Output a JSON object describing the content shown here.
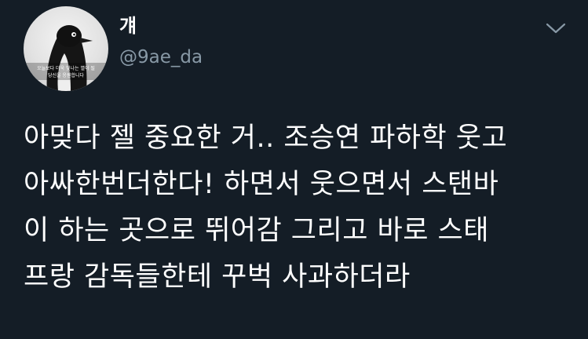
{
  "user": {
    "display_name": "걔",
    "handle": "@9ae_da",
    "avatar_caption_line1": "오늘보다 더욱 빛나는 별이 될",
    "avatar_caption_line2": "당신을 응원합니다"
  },
  "menu": {
    "icon": "chevron-down-icon"
  },
  "tweet": {
    "text": "아맞다 젤 중요한 거.. 조승연 파하학 웃고\n아싸한번더한다! 하면서 웃으면서 스탠바\n이 하는 곳으로 뛰어감 그리고 바로 스태\n프랑 감독들한테 꾸벅 사과하더라"
  },
  "colors": {
    "background": "#141d26",
    "text": "#ffffff",
    "muted": "#8899a6"
  }
}
